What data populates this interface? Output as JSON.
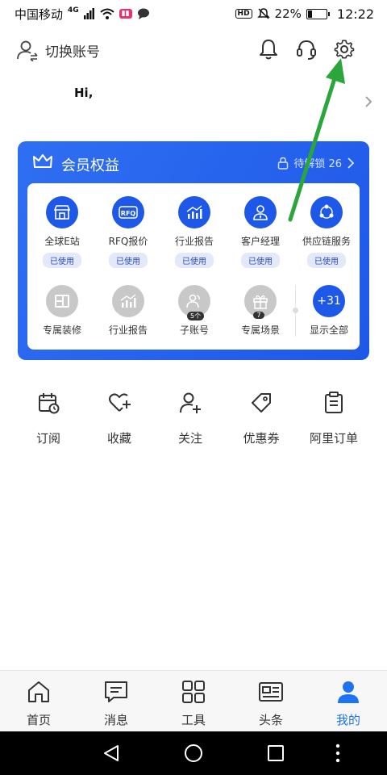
{
  "status_bar": {
    "carrier": "中国移动",
    "network": "4G",
    "hd": "HD",
    "battery_percent": "22%",
    "battery_level": 0.22,
    "time": "12:22"
  },
  "header": {
    "switch_account": "切换账号",
    "greeting": "Hi,"
  },
  "member_card": {
    "title": "会员权益",
    "unlock_text": "待解锁 26",
    "row1": [
      {
        "label": "全球E站",
        "badge": "已使用",
        "icon": "storefront-icon"
      },
      {
        "label": "RFQ报价",
        "badge": "已使用",
        "icon": "rfq-icon"
      },
      {
        "label": "行业报告",
        "badge": "已使用",
        "icon": "chart-icon"
      },
      {
        "label": "客户经理",
        "badge": "已使用",
        "icon": "manager-icon"
      },
      {
        "label": "供应链服务",
        "badge": "已使用",
        "icon": "network-icon"
      }
    ],
    "row2": [
      {
        "label": "专属装修",
        "icon": "layout-icon",
        "count": ""
      },
      {
        "label": "行业报告",
        "icon": "chart-icon",
        "count": ""
      },
      {
        "label": "子账号",
        "icon": "users-icon",
        "count": "5个"
      },
      {
        "label": "专属场景",
        "icon": "gift-icon",
        "count": "7"
      }
    ],
    "show_all": {
      "label": "显示全部",
      "count": "+31"
    }
  },
  "quick_actions": [
    {
      "label": "订阅",
      "icon": "subscribe-icon"
    },
    {
      "label": "收藏",
      "icon": "favorite-icon"
    },
    {
      "label": "关注",
      "icon": "follow-icon"
    },
    {
      "label": "优惠券",
      "icon": "coupon-icon"
    },
    {
      "label": "阿里订单",
      "icon": "orders-icon"
    }
  ],
  "tabs": [
    {
      "label": "首页",
      "icon": "home-icon"
    },
    {
      "label": "消息",
      "icon": "message-icon"
    },
    {
      "label": "工具",
      "icon": "tools-icon"
    },
    {
      "label": "头条",
      "icon": "news-icon"
    },
    {
      "label": "我的",
      "icon": "profile-icon",
      "active": true
    }
  ],
  "colors": {
    "brand_blue": "#1e58e8",
    "tab_active": "#1e74f0",
    "arrow_green": "#2aa63a"
  }
}
